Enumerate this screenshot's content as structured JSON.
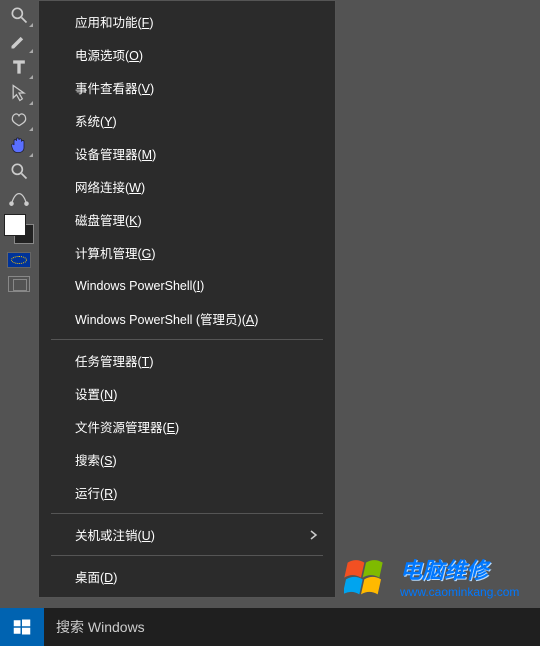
{
  "toolbar": {
    "tools": [
      "magnifier",
      "brush",
      "text",
      "pointer",
      "custom-shape",
      "hand",
      "zoom",
      "bezier"
    ],
    "foreground": "#ffffff",
    "background": "#000000"
  },
  "menu": {
    "items": [
      {
        "pre": "应用和功能(",
        "u": "F",
        "post": ")"
      },
      {
        "pre": "电源选项(",
        "u": "O",
        "post": ")"
      },
      {
        "pre": "事件查看器(",
        "u": "V",
        "post": ")"
      },
      {
        "pre": "系统(",
        "u": "Y",
        "post": ")"
      },
      {
        "pre": "设备管理器(",
        "u": "M",
        "post": ")"
      },
      {
        "pre": "网络连接(",
        "u": "W",
        "post": ")"
      },
      {
        "pre": "磁盘管理(",
        "u": "K",
        "post": ")"
      },
      {
        "pre": "计算机管理(",
        "u": "G",
        "post": ")"
      },
      {
        "pre": "Windows PowerShell(",
        "u": "I",
        "post": ")"
      },
      {
        "pre": "Windows PowerShell (管理员)(",
        "u": "A",
        "post": ")"
      },
      null,
      {
        "pre": "任务管理器(",
        "u": "T",
        "post": ")"
      },
      {
        "pre": "设置(",
        "u": "N",
        "post": ")"
      },
      {
        "pre": "文件资源管理器(",
        "u": "E",
        "post": ")"
      },
      {
        "pre": "搜索(",
        "u": "S",
        "post": ")"
      },
      {
        "pre": "运行(",
        "u": "R",
        "post": ")"
      },
      null,
      {
        "pre": "关机或注销(",
        "u": "U",
        "post": ")",
        "submenu": true
      },
      null,
      {
        "pre": "桌面(",
        "u": "D",
        "post": ")"
      }
    ]
  },
  "taskbar": {
    "search_placeholder": "搜索 Windows"
  },
  "watermark": {
    "title": "电脑维修",
    "url": "www.caominkang.com"
  }
}
